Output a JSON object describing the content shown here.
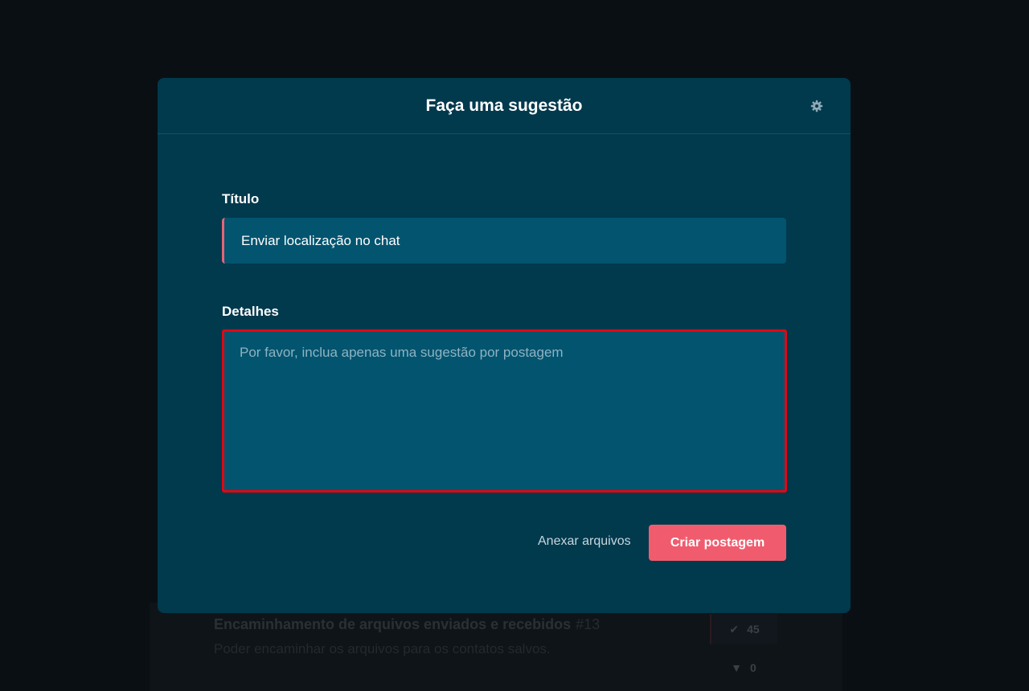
{
  "background": {
    "post": {
      "title": "Encaminhamento de arquivos enviados e recebidos",
      "number": "#13",
      "description": "Poder encaminhar os arquivos para os contatos salvos.",
      "upvotes": "45",
      "downvotes": "0"
    }
  },
  "modal": {
    "title": "Faça uma sugestão",
    "settings_icon": "gear-icon",
    "title_field": {
      "label": "Título",
      "value": "Enviar localização no chat"
    },
    "details_field": {
      "label": "Detalhes",
      "placeholder": "Por favor, inclua apenas uma sugestão por postagem",
      "value": ""
    },
    "attach_label": "Anexar arquivos",
    "submit_label": "Criar postagem"
  },
  "colors": {
    "modal_bg": "#01394d",
    "input_bg": "#02546f",
    "accent": "#f05c6e",
    "highlight_border": "#e30613"
  }
}
